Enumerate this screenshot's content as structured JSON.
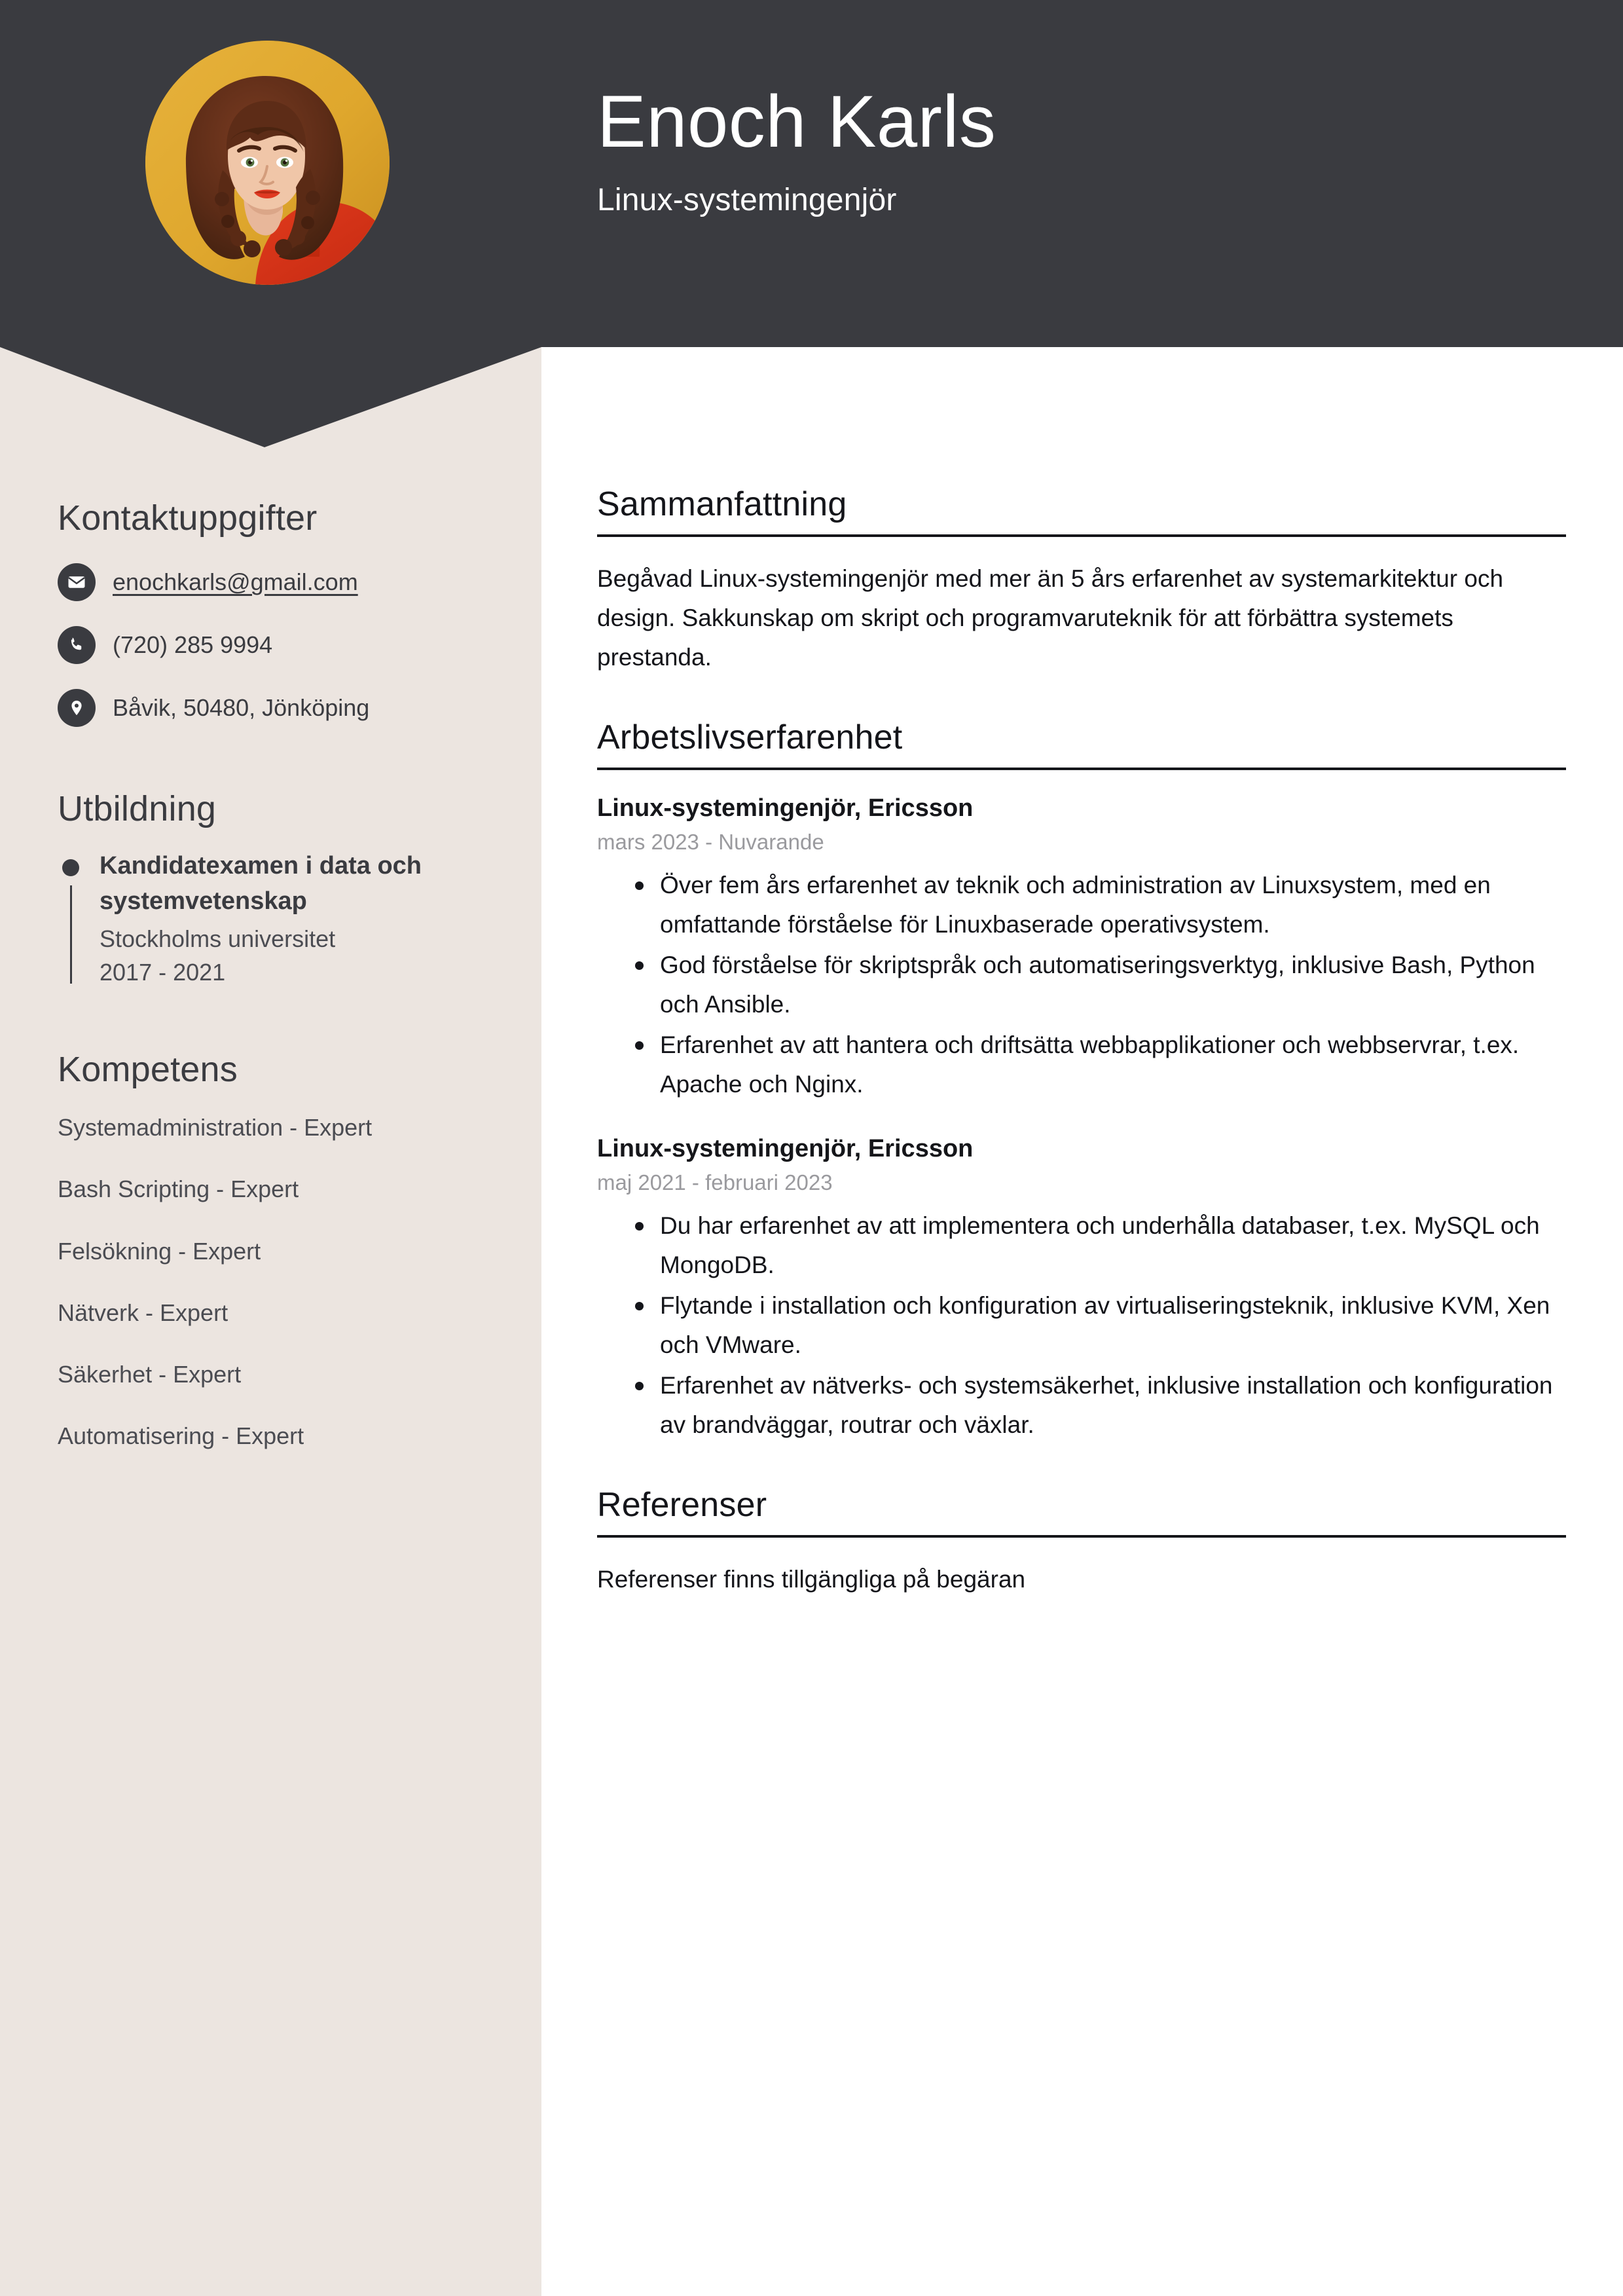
{
  "theme": {
    "header_bg": "#3a3b40",
    "sidebar_bg": "#ece5e0",
    "page_bg": "#ffffff",
    "text_dark": "#14151a",
    "text_muted": "#9a9a9e",
    "avatar_bg": "#dfa72d"
  },
  "header": {
    "name": "Enoch Karls",
    "job_title": "Linux-systemingenjör",
    "avatar_alt": "portrait-photo"
  },
  "sidebar": {
    "contact": {
      "heading": "Kontaktuppgifter",
      "items": [
        {
          "icon": "envelope-icon",
          "value": "enochkarls@gmail.com",
          "link": true
        },
        {
          "icon": "phone-icon",
          "value": "(720) 285 9994",
          "link": false
        },
        {
          "icon": "location-pin-icon",
          "value": "Båvik, 50480, Jönköping",
          "link": false
        }
      ]
    },
    "education": {
      "heading": "Utbildning",
      "items": [
        {
          "degree": "Kandidatexamen i data och systemvetenskap",
          "school": "Stockholms universitet",
          "dates": "2017 - 2021"
        }
      ]
    },
    "skills": {
      "heading": "Kompetens",
      "items": [
        "Systemadministration - Expert",
        "Bash Scripting - Expert",
        "Felsökning - Expert",
        "Nätverk - Expert",
        "Säkerhet - Expert",
        "Automatisering - Expert"
      ]
    }
  },
  "main": {
    "summary": {
      "heading": "Sammanfattning",
      "text": "Begåvad Linux-systemingenjör med mer än 5 års erfarenhet av systemarkitektur och design. Sakkunskap om skript och programvaruteknik för att förbättra systemets prestanda."
    },
    "experience": {
      "heading": "Arbetslivserfarenhet",
      "jobs": [
        {
          "role": "Linux-systemingenjör, Ericsson",
          "dates": "mars 2023 - Nuvarande",
          "points": [
            "Över fem års erfarenhet av teknik och administration av Linuxsystem, med en omfattande förståelse för Linuxbaserade operativsystem.",
            "God förståelse för skriptspråk och automatiseringsverktyg, inklusive Bash, Python och Ansible.",
            "Erfarenhet av att hantera och driftsätta webbapplikationer och webbservrar, t.ex. Apache och Nginx."
          ]
        },
        {
          "role": "Linux-systemingenjör, Ericsson",
          "dates": "maj 2021 - februari 2023",
          "points": [
            "Du har erfarenhet av att implementera och underhålla databaser, t.ex. MySQL och MongoDB.",
            "Flytande i installation och konfiguration av virtualiseringsteknik, inklusive KVM, Xen och VMware.",
            "Erfarenhet av nätverks- och systemsäkerhet, inklusive installation och konfiguration av brandväggar, routrar och växlar."
          ]
        }
      ]
    },
    "references": {
      "heading": "Referenser",
      "text": "Referenser finns tillgängliga på begäran"
    }
  }
}
